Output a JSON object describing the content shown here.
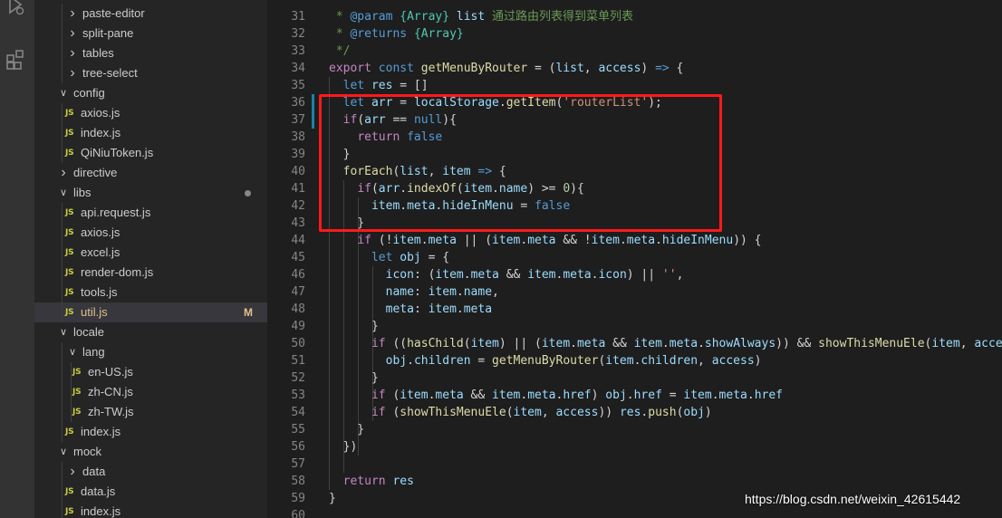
{
  "explorer": {
    "items": [
      {
        "label": "paste-editor",
        "kind": "folder",
        "expanded": false,
        "depth": 2
      },
      {
        "label": "split-pane",
        "kind": "folder",
        "expanded": false,
        "depth": 2
      },
      {
        "label": "tables",
        "kind": "folder",
        "expanded": false,
        "depth": 2
      },
      {
        "label": "tree-select",
        "kind": "folder",
        "expanded": false,
        "depth": 2
      },
      {
        "label": "config",
        "kind": "folder",
        "expanded": true,
        "depth": 1
      },
      {
        "label": "axios.js",
        "kind": "js",
        "depth": 2
      },
      {
        "label": "index.js",
        "kind": "js",
        "depth": 2
      },
      {
        "label": "QiNiuToken.js",
        "kind": "js",
        "depth": 2
      },
      {
        "label": "directive",
        "kind": "folder",
        "expanded": false,
        "depth": 1
      },
      {
        "label": "libs",
        "kind": "folder",
        "expanded": true,
        "depth": 1,
        "dot": true
      },
      {
        "label": "api.request.js",
        "kind": "js",
        "depth": 2
      },
      {
        "label": "axios.js",
        "kind": "js",
        "depth": 2
      },
      {
        "label": "excel.js",
        "kind": "js",
        "depth": 2
      },
      {
        "label": "render-dom.js",
        "kind": "js",
        "depth": 2
      },
      {
        "label": "tools.js",
        "kind": "js",
        "depth": 2
      },
      {
        "label": "util.js",
        "kind": "js",
        "depth": 2,
        "active": true,
        "git": "M"
      },
      {
        "label": "locale",
        "kind": "folder",
        "expanded": true,
        "depth": 1
      },
      {
        "label": "lang",
        "kind": "folder",
        "expanded": true,
        "depth": 2
      },
      {
        "label": "en-US.js",
        "kind": "js",
        "depth": 3
      },
      {
        "label": "zh-CN.js",
        "kind": "js",
        "depth": 3
      },
      {
        "label": "zh-TW.js",
        "kind": "js",
        "depth": 3
      },
      {
        "label": "index.js",
        "kind": "js",
        "depth": 2
      },
      {
        "label": "mock",
        "kind": "folder",
        "expanded": true,
        "depth": 1
      },
      {
        "label": "data",
        "kind": "folder",
        "expanded": false,
        "depth": 2
      },
      {
        "label": "data.js",
        "kind": "js",
        "depth": 2
      },
      {
        "label": "index.js",
        "kind": "js",
        "depth": 2
      }
    ],
    "js_badge": "JS"
  },
  "editor": {
    "lines": [
      {
        "n": "31",
        "tokens": [
          [
            " * ",
            "cmt"
          ],
          [
            "@param",
            "kw"
          ],
          [
            " ",
            "cmt"
          ],
          [
            "{Array}",
            "cls"
          ],
          [
            " ",
            "cmt"
          ],
          [
            "list",
            "var"
          ],
          [
            " 通过路由列表得到菜单列表",
            "cmt"
          ]
        ]
      },
      {
        "n": "32",
        "tokens": [
          [
            " * ",
            "cmt"
          ],
          [
            "@returns",
            "kw"
          ],
          [
            " ",
            "cmt"
          ],
          [
            "{Array}",
            "cls"
          ]
        ]
      },
      {
        "n": "33",
        "tokens": [
          [
            " */",
            "cmt"
          ]
        ]
      },
      {
        "n": "34",
        "tokens": [
          [
            "export",
            "ctl"
          ],
          [
            " ",
            "plain"
          ],
          [
            "const",
            "kw"
          ],
          [
            " ",
            "plain"
          ],
          [
            "getMenuByRouter",
            "fn"
          ],
          [
            " = (",
            "plain"
          ],
          [
            "list",
            "var"
          ],
          [
            ", ",
            "plain"
          ],
          [
            "access",
            "var"
          ],
          [
            ") ",
            "plain"
          ],
          [
            "=>",
            "kw"
          ],
          [
            " {",
            "plain"
          ]
        ]
      },
      {
        "n": "35",
        "tokens": [
          [
            "  ",
            "plain"
          ],
          [
            "let",
            "kw"
          ],
          [
            " ",
            "plain"
          ],
          [
            "res",
            "var"
          ],
          [
            " = []",
            "plain"
          ]
        ]
      },
      {
        "n": "36",
        "tokens": [
          [
            "  ",
            "plain"
          ],
          [
            "let",
            "kw"
          ],
          [
            " ",
            "plain"
          ],
          [
            "arr",
            "var"
          ],
          [
            " = ",
            "plain"
          ],
          [
            "localStorage",
            "var"
          ],
          [
            ".",
            "plain"
          ],
          [
            "getItem",
            "fn"
          ],
          [
            "(",
            "plain"
          ],
          [
            "'routerList'",
            "str"
          ],
          [
            ");",
            "plain"
          ]
        ]
      },
      {
        "n": "37",
        "tokens": [
          [
            "  ",
            "plain"
          ],
          [
            "if",
            "ctl"
          ],
          [
            "(",
            "plain"
          ],
          [
            "arr",
            "var"
          ],
          [
            " == ",
            "plain"
          ],
          [
            "null",
            "kw"
          ],
          [
            "){",
            "plain"
          ]
        ]
      },
      {
        "n": "38",
        "tokens": [
          [
            "    ",
            "plain"
          ],
          [
            "return",
            "ctl"
          ],
          [
            " ",
            "plain"
          ],
          [
            "false",
            "kw"
          ]
        ]
      },
      {
        "n": "39",
        "tokens": [
          [
            "  }",
            "plain"
          ]
        ]
      },
      {
        "n": "40",
        "tokens": [
          [
            "  ",
            "plain"
          ],
          [
            "forEach",
            "fn"
          ],
          [
            "(",
            "plain"
          ],
          [
            "list",
            "var"
          ],
          [
            ", ",
            "plain"
          ],
          [
            "item",
            "var"
          ],
          [
            " ",
            "plain"
          ],
          [
            "=>",
            "kw"
          ],
          [
            " {",
            "plain"
          ]
        ]
      },
      {
        "n": "41",
        "tokens": [
          [
            "    ",
            "plain"
          ],
          [
            "if",
            "ctl"
          ],
          [
            "(",
            "plain"
          ],
          [
            "arr",
            "var"
          ],
          [
            ".",
            "plain"
          ],
          [
            "indexOf",
            "fn"
          ],
          [
            "(",
            "plain"
          ],
          [
            "item",
            "var"
          ],
          [
            ".",
            "plain"
          ],
          [
            "name",
            "var"
          ],
          [
            ") >= ",
            "plain"
          ],
          [
            "0",
            "num"
          ],
          [
            "){",
            "plain"
          ]
        ]
      },
      {
        "n": "42",
        "tokens": [
          [
            "      ",
            "plain"
          ],
          [
            "item",
            "var"
          ],
          [
            ".",
            "plain"
          ],
          [
            "meta",
            "var"
          ],
          [
            ".",
            "plain"
          ],
          [
            "hideInMenu",
            "var"
          ],
          [
            " = ",
            "plain"
          ],
          [
            "false",
            "kw"
          ]
        ]
      },
      {
        "n": "43",
        "tokens": [
          [
            "    }",
            "plain"
          ]
        ]
      },
      {
        "n": "44",
        "tokens": [
          [
            "    ",
            "plain"
          ],
          [
            "if",
            "ctl"
          ],
          [
            " (!",
            "plain"
          ],
          [
            "item",
            "var"
          ],
          [
            ".",
            "plain"
          ],
          [
            "meta",
            "var"
          ],
          [
            " || (",
            "plain"
          ],
          [
            "item",
            "var"
          ],
          [
            ".",
            "plain"
          ],
          [
            "meta",
            "var"
          ],
          [
            " && !",
            "plain"
          ],
          [
            "item",
            "var"
          ],
          [
            ".",
            "plain"
          ],
          [
            "meta",
            "var"
          ],
          [
            ".",
            "plain"
          ],
          [
            "hideInMenu",
            "var"
          ],
          [
            ")) {",
            "plain"
          ]
        ]
      },
      {
        "n": "45",
        "tokens": [
          [
            "      ",
            "plain"
          ],
          [
            "let",
            "kw"
          ],
          [
            " ",
            "plain"
          ],
          [
            "obj",
            "var"
          ],
          [
            " = {",
            "plain"
          ]
        ]
      },
      {
        "n": "46",
        "tokens": [
          [
            "        ",
            "plain"
          ],
          [
            "icon",
            "var"
          ],
          [
            ": (",
            "plain"
          ],
          [
            "item",
            "var"
          ],
          [
            ".",
            "plain"
          ],
          [
            "meta",
            "var"
          ],
          [
            " && ",
            "plain"
          ],
          [
            "item",
            "var"
          ],
          [
            ".",
            "plain"
          ],
          [
            "meta",
            "var"
          ],
          [
            ".",
            "plain"
          ],
          [
            "icon",
            "var"
          ],
          [
            ") || ",
            "plain"
          ],
          [
            "''",
            "str"
          ],
          [
            ",",
            "plain"
          ]
        ]
      },
      {
        "n": "47",
        "tokens": [
          [
            "        ",
            "plain"
          ],
          [
            "name",
            "var"
          ],
          [
            ": ",
            "plain"
          ],
          [
            "item",
            "var"
          ],
          [
            ".",
            "plain"
          ],
          [
            "name",
            "var"
          ],
          [
            ",",
            "plain"
          ]
        ]
      },
      {
        "n": "48",
        "tokens": [
          [
            "        ",
            "plain"
          ],
          [
            "meta",
            "var"
          ],
          [
            ": ",
            "plain"
          ],
          [
            "item",
            "var"
          ],
          [
            ".",
            "plain"
          ],
          [
            "meta",
            "var"
          ]
        ]
      },
      {
        "n": "49",
        "tokens": [
          [
            "      }",
            "plain"
          ]
        ]
      },
      {
        "n": "50",
        "tokens": [
          [
            "      ",
            "plain"
          ],
          [
            "if",
            "ctl"
          ],
          [
            " ((",
            "plain"
          ],
          [
            "hasChild",
            "fn"
          ],
          [
            "(",
            "plain"
          ],
          [
            "item",
            "var"
          ],
          [
            ") || (",
            "plain"
          ],
          [
            "item",
            "var"
          ],
          [
            ".",
            "plain"
          ],
          [
            "meta",
            "var"
          ],
          [
            " && ",
            "plain"
          ],
          [
            "item",
            "var"
          ],
          [
            ".",
            "plain"
          ],
          [
            "meta",
            "var"
          ],
          [
            ".",
            "plain"
          ],
          [
            "showAlways",
            "var"
          ],
          [
            ")) && ",
            "plain"
          ],
          [
            "showThisMenuEle",
            "fn"
          ],
          [
            "(",
            "plain"
          ],
          [
            "item",
            "var"
          ],
          [
            ", ",
            "plain"
          ],
          [
            "access",
            "var"
          ]
        ]
      },
      {
        "n": "51",
        "tokens": [
          [
            "        ",
            "plain"
          ],
          [
            "obj",
            "var"
          ],
          [
            ".",
            "plain"
          ],
          [
            "children",
            "var"
          ],
          [
            " = ",
            "plain"
          ],
          [
            "getMenuByRouter",
            "fn"
          ],
          [
            "(",
            "plain"
          ],
          [
            "item",
            "var"
          ],
          [
            ".",
            "plain"
          ],
          [
            "children",
            "var"
          ],
          [
            ", ",
            "plain"
          ],
          [
            "access",
            "var"
          ],
          [
            ")",
            "plain"
          ]
        ]
      },
      {
        "n": "52",
        "tokens": [
          [
            "      }",
            "plain"
          ]
        ]
      },
      {
        "n": "53",
        "tokens": [
          [
            "      ",
            "plain"
          ],
          [
            "if",
            "ctl"
          ],
          [
            " (",
            "plain"
          ],
          [
            "item",
            "var"
          ],
          [
            ".",
            "plain"
          ],
          [
            "meta",
            "var"
          ],
          [
            " && ",
            "plain"
          ],
          [
            "item",
            "var"
          ],
          [
            ".",
            "plain"
          ],
          [
            "meta",
            "var"
          ],
          [
            ".",
            "plain"
          ],
          [
            "href",
            "var"
          ],
          [
            ") ",
            "plain"
          ],
          [
            "obj",
            "var"
          ],
          [
            ".",
            "plain"
          ],
          [
            "href",
            "var"
          ],
          [
            " = ",
            "plain"
          ],
          [
            "item",
            "var"
          ],
          [
            ".",
            "plain"
          ],
          [
            "meta",
            "var"
          ],
          [
            ".",
            "plain"
          ],
          [
            "href",
            "var"
          ]
        ]
      },
      {
        "n": "54",
        "tokens": [
          [
            "      ",
            "plain"
          ],
          [
            "if",
            "ctl"
          ],
          [
            " (",
            "plain"
          ],
          [
            "showThisMenuEle",
            "fn"
          ],
          [
            "(",
            "plain"
          ],
          [
            "item",
            "var"
          ],
          [
            ", ",
            "plain"
          ],
          [
            "access",
            "var"
          ],
          [
            ")) ",
            "plain"
          ],
          [
            "res",
            "var"
          ],
          [
            ".",
            "plain"
          ],
          [
            "push",
            "fn"
          ],
          [
            "(",
            "plain"
          ],
          [
            "obj",
            "var"
          ],
          [
            ")",
            "plain"
          ]
        ]
      },
      {
        "n": "55",
        "tokens": [
          [
            "    }",
            "plain"
          ]
        ]
      },
      {
        "n": "56",
        "tokens": [
          [
            "  })",
            "plain"
          ]
        ]
      },
      {
        "n": "57",
        "tokens": []
      },
      {
        "n": "58",
        "tokens": [
          [
            "  ",
            "plain"
          ],
          [
            "return",
            "ctl"
          ],
          [
            " ",
            "plain"
          ],
          [
            "res",
            "var"
          ]
        ]
      },
      {
        "n": "59",
        "tokens": [
          [
            "}",
            "plain"
          ]
        ]
      },
      {
        "n": "60",
        "tokens": []
      }
    ]
  },
  "watermark": "https://blog.csdn.net/weixin_42615442",
  "colors": {
    "highlight_border": "#ff1a1a",
    "js_badge": "#cbcb41",
    "modified": "#e2c08d"
  },
  "icons": [
    "debug-icon",
    "extensions-icon",
    "chevron-right-icon",
    "chevron-down-icon",
    "js-file-icon"
  ]
}
